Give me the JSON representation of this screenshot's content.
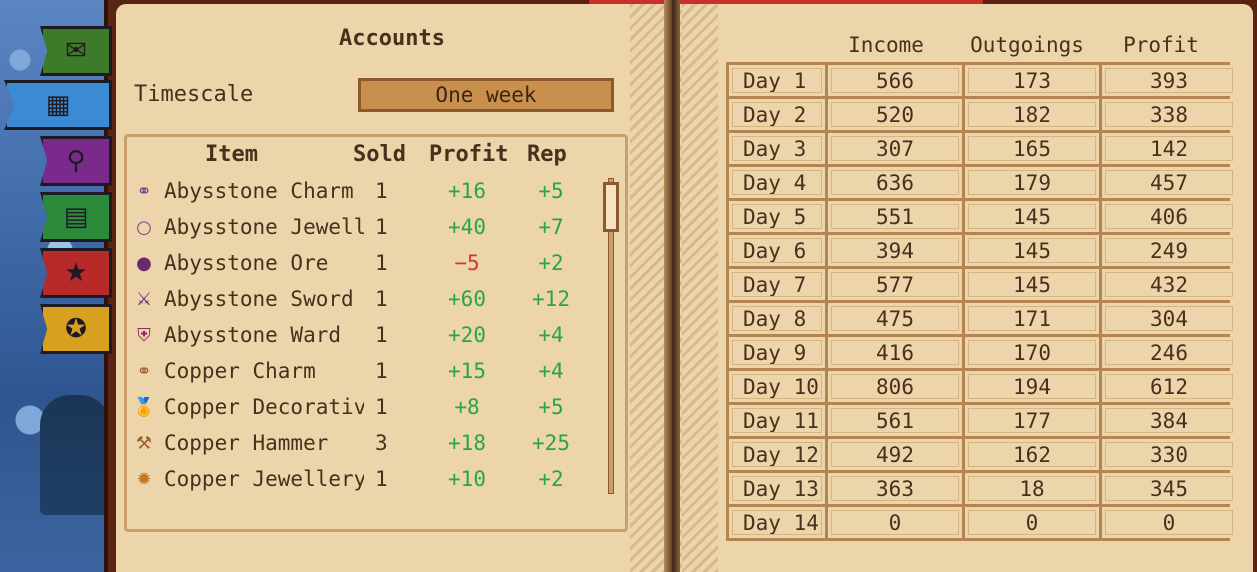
{
  "accounts": {
    "title": "Accounts",
    "timescale_label": "Timescale",
    "timescale_value": "One week"
  },
  "tabs": [
    {
      "name": "tab-envelope",
      "icon": "envelope-icon",
      "glyph": "✉",
      "color": "#3d7a2a",
      "active": false
    },
    {
      "name": "tab-accounts",
      "icon": "abacus-icon",
      "glyph": "▦",
      "color": "#3a8ad4",
      "active": true
    },
    {
      "name": "tab-customers",
      "icon": "magnifier-icon",
      "glyph": "⚲",
      "color": "#7a2a8a",
      "active": false
    },
    {
      "name": "tab-schedule",
      "icon": "calendar-icon",
      "glyph": "▤",
      "color": "#2a8a3a",
      "active": false
    },
    {
      "name": "tab-ratings",
      "icon": "stars-icon",
      "glyph": "★",
      "color": "#b82a2a",
      "active": false
    },
    {
      "name": "tab-awards",
      "icon": "ribbon-icon",
      "glyph": "✪",
      "color": "#d8a020",
      "active": false
    }
  ],
  "items_header": {
    "item": "Item",
    "sold": "Sold",
    "profit": "Profit",
    "rep": "Rep"
  },
  "items": [
    {
      "icon": "charm-icon",
      "glyph": "⚭",
      "icon_color": "#8a3a8a",
      "name": "Abysstone Charm",
      "sold": "1",
      "profit": "+16",
      "profit_sign": "pos",
      "rep": "+5"
    },
    {
      "icon": "jewellery-icon",
      "glyph": "○",
      "icon_color": "#8a3a8a",
      "name": "Abysstone Jewell…",
      "sold": "1",
      "profit": "+40",
      "profit_sign": "pos",
      "rep": "+7"
    },
    {
      "icon": "ore-icon",
      "glyph": "●",
      "icon_color": "#6a2a6a",
      "name": "Abysstone Ore",
      "sold": "1",
      "profit": "−5",
      "profit_sign": "neg",
      "rep": "+2"
    },
    {
      "icon": "sword-icon",
      "glyph": "⚔",
      "icon_color": "#6a2a8a",
      "name": "Abysstone Sword",
      "sold": "1",
      "profit": "+60",
      "profit_sign": "pos",
      "rep": "+12"
    },
    {
      "icon": "shield-icon",
      "glyph": "⛨",
      "icon_color": "#8a2a6a",
      "name": "Abysstone Ward",
      "sold": "1",
      "profit": "+20",
      "profit_sign": "pos",
      "rep": "+4"
    },
    {
      "icon": "charm-icon",
      "glyph": "⚭",
      "icon_color": "#a0602a",
      "name": "Copper Charm",
      "sold": "1",
      "profit": "+15",
      "profit_sign": "pos",
      "rep": "+4"
    },
    {
      "icon": "medal-icon",
      "glyph": "🏅",
      "icon_color": "#d89a2a",
      "name": "Copper Decorative",
      "sold": "1",
      "profit": "+8",
      "profit_sign": "pos",
      "rep": "+5"
    },
    {
      "icon": "hammer-icon",
      "glyph": "⚒",
      "icon_color": "#a0602a",
      "name": "Copper Hammer",
      "sold": "3",
      "profit": "+18",
      "profit_sign": "pos",
      "rep": "+25"
    },
    {
      "icon": "jewellery-icon",
      "glyph": "✹",
      "icon_color": "#c07a2a",
      "name": "Copper Jewellery",
      "sold": "1",
      "profit": "+10",
      "profit_sign": "pos",
      "rep": "+2"
    }
  ],
  "days_header": {
    "income": "Income",
    "outgoings": "Outgoings",
    "profit": "Profit"
  },
  "days": [
    {
      "day": "Day 1",
      "income": "566",
      "outgoings": "173",
      "profit": "393"
    },
    {
      "day": "Day 2",
      "income": "520",
      "outgoings": "182",
      "profit": "338"
    },
    {
      "day": "Day 3",
      "income": "307",
      "outgoings": "165",
      "profit": "142"
    },
    {
      "day": "Day 4",
      "income": "636",
      "outgoings": "179",
      "profit": "457"
    },
    {
      "day": "Day 5",
      "income": "551",
      "outgoings": "145",
      "profit": "406"
    },
    {
      "day": "Day 6",
      "income": "394",
      "outgoings": "145",
      "profit": "249"
    },
    {
      "day": "Day 7",
      "income": "577",
      "outgoings": "145",
      "profit": "432"
    },
    {
      "day": "Day 8",
      "income": "475",
      "outgoings": "171",
      "profit": "304"
    },
    {
      "day": "Day 9",
      "income": "416",
      "outgoings": "170",
      "profit": "246"
    },
    {
      "day": "Day 10",
      "income": "806",
      "outgoings": "194",
      "profit": "612"
    },
    {
      "day": "Day 11",
      "income": "561",
      "outgoings": "177",
      "profit": "384"
    },
    {
      "day": "Day 12",
      "income": "492",
      "outgoings": "162",
      "profit": "330"
    },
    {
      "day": "Day 13",
      "income": "363",
      "outgoings": "18",
      "profit": "345"
    },
    {
      "day": "Day 14",
      "income": "0",
      "outgoings": "0",
      "profit": "0"
    }
  ]
}
